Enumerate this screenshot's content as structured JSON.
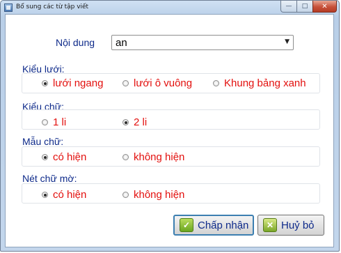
{
  "window": {
    "title": "Bổ sung các từ tập viết",
    "minimize_glyph": "—",
    "maximize_glyph": "□",
    "close_glyph": "✕"
  },
  "content": {
    "label": "Nội dung",
    "selected_value": "an",
    "dropdown_arrow": "▼"
  },
  "groups": {
    "grid": {
      "title": "Kiểu lưới:",
      "options": [
        "lưới ngang",
        "lưới ô vuông",
        "Khung bảng xanh"
      ],
      "selected": 0
    },
    "font": {
      "title": "Kiểu chữ:",
      "options": [
        "1 li",
        "2 li"
      ],
      "selected": 1
    },
    "sample": {
      "title": "Mẫu chữ:",
      "options": [
        "có hiện",
        "không hiện"
      ],
      "selected": 0
    },
    "faded": {
      "title": "Nét chữ mờ:",
      "options": [
        "có hiện",
        "không hiện"
      ],
      "selected": 0
    }
  },
  "buttons": {
    "ok": "Chấp nhận",
    "ok_icon": "✓",
    "cancel": "Huỷ bỏ",
    "cancel_icon": "✕"
  }
}
